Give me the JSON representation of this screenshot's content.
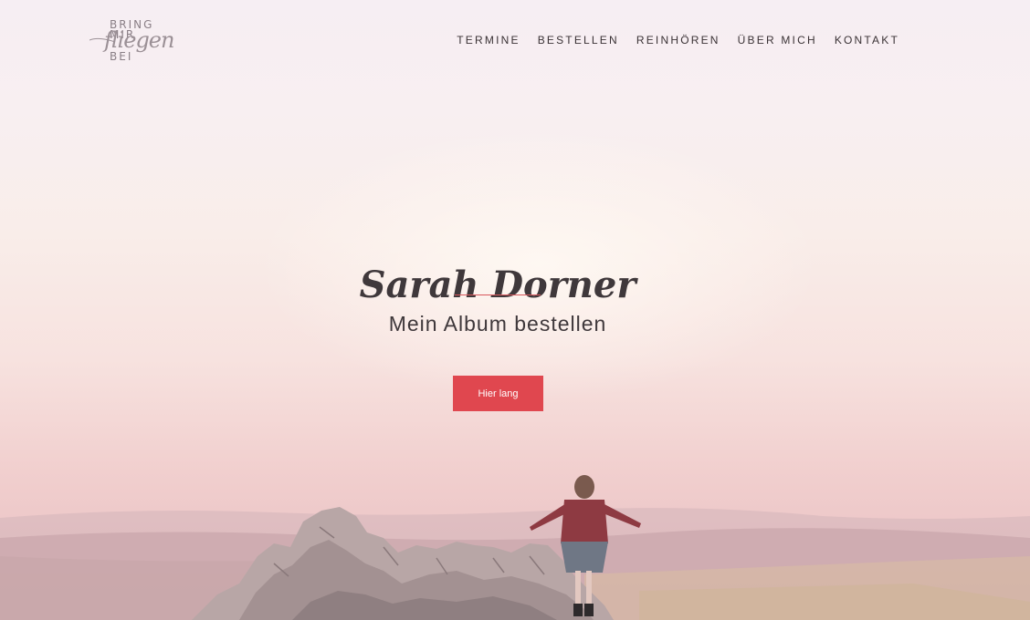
{
  "logo": {
    "line1": "BRING",
    "line2": "MIR",
    "script": "fliegen",
    "line3": "BEI"
  },
  "nav": {
    "items": [
      {
        "label": "TERMINE"
      },
      {
        "label": "BESTELLEN"
      },
      {
        "label": "REINHÖREN"
      },
      {
        "label": "ÜBER MICH"
      },
      {
        "label": "KONTAKT"
      }
    ]
  },
  "hero": {
    "title": "Sarah Dorner",
    "subtitle": "Mein Album bestellen",
    "cta_label": "Hier lang"
  },
  "colors": {
    "accent": "#e0474f",
    "text": "#3f383b"
  }
}
